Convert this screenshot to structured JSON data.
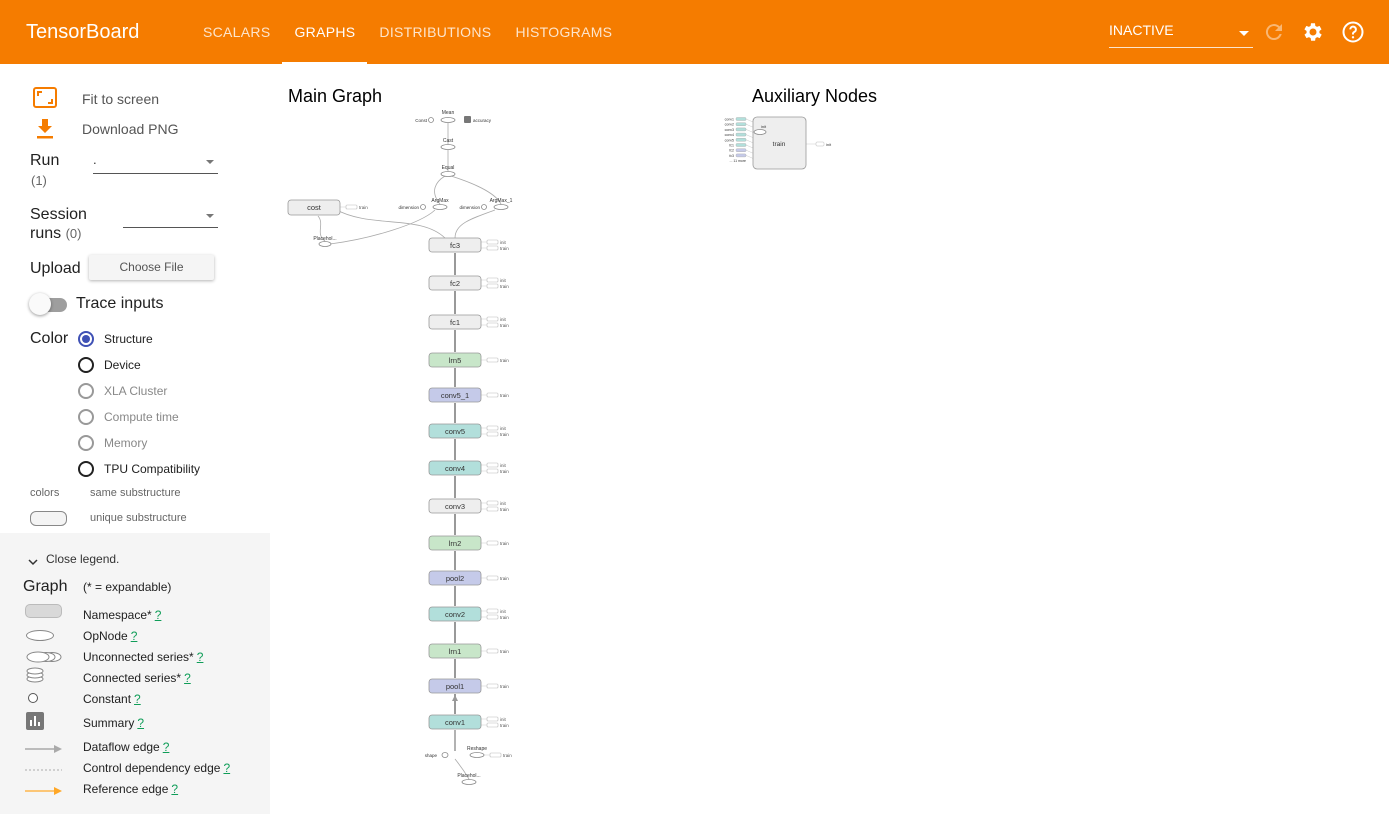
{
  "app": {
    "title": "TensorBoard",
    "brand_color": "#f57c00"
  },
  "tabs": [
    {
      "label": "SCALARS",
      "active": false
    },
    {
      "label": "GRAPHS",
      "active": true
    },
    {
      "label": "DISTRIBUTIONS",
      "active": false
    },
    {
      "label": "HISTOGRAMS",
      "active": false
    }
  ],
  "header": {
    "status_select": "INACTIVE",
    "icons": [
      "refresh-icon",
      "settings-icon",
      "help-icon"
    ]
  },
  "sidebar": {
    "fit_to_screen": "Fit to screen",
    "download_png": "Download PNG",
    "run_label": "Run",
    "run_count": "(1)",
    "run_value": ".",
    "session_label_1": "Session",
    "session_label_2": "runs",
    "session_count": "(0)",
    "session_value": "",
    "upload_label": "Upload",
    "choose_file": "Choose File",
    "trace_inputs": "Trace inputs",
    "color_label": "Color",
    "color_options": [
      {
        "label": "Structure",
        "state": "selected"
      },
      {
        "label": "Device",
        "state": "enabled"
      },
      {
        "label": "XLA Cluster",
        "state": "disabled"
      },
      {
        "label": "Compute time",
        "state": "disabled"
      },
      {
        "label": "Memory",
        "state": "disabled"
      },
      {
        "label": "TPU Compatibility",
        "state": "enabled"
      }
    ],
    "colors_label": "colors",
    "same_substructure": "same substructure",
    "unique_substructure": "unique substructure"
  },
  "legend": {
    "close_label": "Close legend.",
    "graph_label": "Graph",
    "expandable_note": "(* = expandable)",
    "items": [
      {
        "label": "Namespace*",
        "help": "?"
      },
      {
        "label": "OpNode",
        "help": "?"
      },
      {
        "label": "Unconnected series*",
        "help": "?"
      },
      {
        "label": "Connected series*",
        "help": "?"
      },
      {
        "label": "Constant",
        "help": "?"
      },
      {
        "label": "Summary",
        "help": "?"
      },
      {
        "label": "Dataflow edge",
        "help": "?"
      },
      {
        "label": "Control dependency edge",
        "help": "?"
      },
      {
        "label": "Reference edge",
        "help": "?"
      }
    ]
  },
  "graph": {
    "main_title": "Main Graph",
    "aux_title": "Auxiliary Nodes",
    "top_nodes": {
      "mean": "Mean",
      "const": "Const",
      "cast": "Cast",
      "equal": "Equal",
      "argmax": "ArgMax",
      "argmax_1": "ArgMax_1",
      "dimension": "dimension",
      "cost": "cost",
      "placeholder": "Placehol...",
      "reshape": "Reshape",
      "shape": "shape",
      "placeholder_bottom": "Placehol...",
      "accuracy": "accuracy"
    },
    "chain": [
      {
        "label": "fc3",
        "kind": "namespace",
        "side": [
          "init",
          "train"
        ]
      },
      {
        "label": "fc2",
        "kind": "namespace",
        "side": [
          "init",
          "train"
        ]
      },
      {
        "label": "fc1",
        "kind": "namespace",
        "side": [
          "init",
          "train"
        ]
      },
      {
        "label": "lrn5",
        "kind": "lrn",
        "side": [
          "train"
        ]
      },
      {
        "label": "conv5_1",
        "kind": "pool",
        "side": [
          "train"
        ]
      },
      {
        "label": "conv5",
        "kind": "conv",
        "side": [
          "init",
          "train"
        ]
      },
      {
        "label": "conv4",
        "kind": "conv",
        "side": [
          "init",
          "train"
        ]
      },
      {
        "label": "conv3",
        "kind": "namespace",
        "side": [
          "init",
          "train"
        ]
      },
      {
        "label": "lrn2",
        "kind": "lrn",
        "side": [
          "train"
        ]
      },
      {
        "label": "pool2",
        "kind": "pool",
        "side": [
          "train"
        ]
      },
      {
        "label": "conv2",
        "kind": "conv",
        "side": [
          "init",
          "train"
        ]
      },
      {
        "label": "lrn1",
        "kind": "lrn",
        "side": [
          "train"
        ]
      },
      {
        "label": "pool1",
        "kind": "pool",
        "side": [
          "train"
        ]
      },
      {
        "label": "conv1",
        "kind": "conv",
        "side": [
          "init",
          "train"
        ]
      }
    ],
    "train_label": "train",
    "cost_side": "train",
    "aux": {
      "node": "train",
      "init": "init",
      "out": "init",
      "more": "... 11 more",
      "inputs": [
        "conv1",
        "conv2",
        "conv3",
        "conv4",
        "conv5",
        "fc1",
        "fc2",
        "fc3"
      ]
    },
    "colors": {
      "namespace": "#eeeeee",
      "conv": "#b2dfdb",
      "pool": "#c5cae9",
      "lrn": "#c8e6c9",
      "stroke": "#999999"
    }
  }
}
